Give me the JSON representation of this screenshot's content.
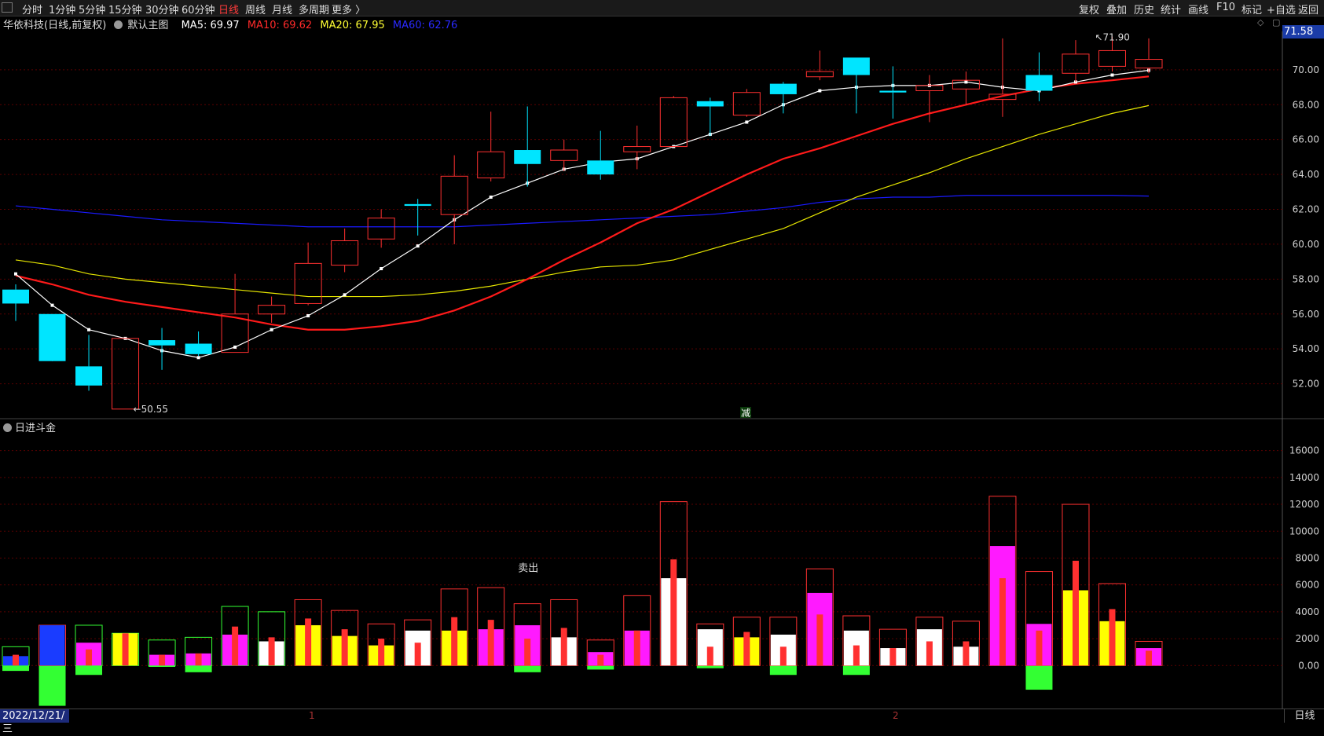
{
  "toolbar": {
    "periods": [
      "分时",
      "1分钟",
      "5分钟",
      "15分钟",
      "30分钟",
      "60分钟",
      "日线",
      "周线",
      "月线",
      "多周期",
      "更多 〉"
    ],
    "active_period": "日线",
    "right_items": [
      "复权",
      "叠加",
      "历史",
      "统计",
      "画线",
      "F10",
      "标记",
      "+自选",
      "返回"
    ]
  },
  "stock": {
    "name": "华依科技(日线,前复权)",
    "template": "默认主图",
    "ma5": "MA5: 69.97",
    "ma10": "MA10: 69.62",
    "ma20": "MA20: 67.95",
    "ma60": "MA60: 62.76"
  },
  "colors": {
    "up": "#ff3030",
    "down": "#00e5ff",
    "ma5": "#ffffff",
    "ma10": "#ff1a1a",
    "ma20": "#e6e600",
    "ma60": "#1a1aff",
    "grid": "#5a0000",
    "axis_text": "#d0d0d0",
    "magenta": "#ff1aff",
    "green": "#33ff33",
    "blue": "#1a3cff",
    "yellow": "#ffff00"
  },
  "price_axis": {
    "ticks": [
      "70.00",
      "68.00",
      "66.00",
      "64.00",
      "62.00",
      "60.00",
      "58.00",
      "56.00",
      "54.00",
      "52.00"
    ],
    "current": "71.58"
  },
  "annotations": {
    "high": "71.90",
    "low": "50.55",
    "mid_marker": "减",
    "sell": "卖出"
  },
  "panel2": {
    "title": "日进斗金",
    "ticks": [
      "16000",
      "14000",
      "12000",
      "10000",
      "8000",
      "6000",
      "4000",
      "2000",
      "0.00"
    ]
  },
  "bottom": {
    "date": "2022/12/21/三",
    "period": "日线",
    "month1": "1",
    "month2": "2"
  },
  "chart_data": [
    {
      "type": "candlestick",
      "ylim": [
        50,
        72.2
      ],
      "candles": [
        {
          "o": 57.4,
          "h": 57.7,
          "l": 55.6,
          "c": 56.6
        },
        {
          "o": 56.0,
          "h": 56.0,
          "l": 53.4,
          "c": 53.3
        },
        {
          "o": 53.0,
          "h": 54.8,
          "l": 51.6,
          "c": 51.9
        },
        {
          "o": 50.55,
          "h": 54.6,
          "l": 50.55,
          "c": 54.6
        },
        {
          "o": 54.5,
          "h": 55.2,
          "l": 52.8,
          "c": 54.2
        },
        {
          "o": 54.3,
          "h": 55.0,
          "l": 53.6,
          "c": 53.7
        },
        {
          "o": 53.8,
          "h": 58.3,
          "l": 53.8,
          "c": 56.0
        },
        {
          "o": 56.0,
          "h": 57.0,
          "l": 55.5,
          "c": 56.5
        },
        {
          "o": 56.6,
          "h": 60.1,
          "l": 56.5,
          "c": 58.9
        },
        {
          "o": 58.8,
          "h": 60.9,
          "l": 58.4,
          "c": 60.2
        },
        {
          "o": 60.3,
          "h": 62.0,
          "l": 59.8,
          "c": 61.5
        },
        {
          "o": 62.3,
          "h": 62.6,
          "l": 60.5,
          "c": 62.2
        },
        {
          "o": 61.7,
          "h": 65.1,
          "l": 60.0,
          "c": 63.9
        },
        {
          "o": 63.8,
          "h": 67.6,
          "l": 63.6,
          "c": 65.3
        },
        {
          "o": 65.4,
          "h": 67.9,
          "l": 63.3,
          "c": 64.6
        },
        {
          "o": 64.8,
          "h": 66.0,
          "l": 64.2,
          "c": 65.4
        },
        {
          "o": 64.8,
          "h": 66.5,
          "l": 63.7,
          "c": 64.0
        },
        {
          "o": 65.3,
          "h": 66.8,
          "l": 64.3,
          "c": 65.6
        },
        {
          "o": 65.6,
          "h": 68.5,
          "l": 65.6,
          "c": 68.4
        },
        {
          "o": 68.2,
          "h": 68.4,
          "l": 66.2,
          "c": 67.9
        },
        {
          "o": 67.4,
          "h": 68.9,
          "l": 67.3,
          "c": 68.7
        },
        {
          "o": 69.2,
          "h": 69.3,
          "l": 67.5,
          "c": 68.6
        },
        {
          "o": 69.6,
          "h": 71.1,
          "l": 69.4,
          "c": 69.9
        },
        {
          "o": 70.7,
          "h": 70.7,
          "l": 67.5,
          "c": 69.7
        },
        {
          "o": 68.8,
          "h": 70.2,
          "l": 67.2,
          "c": 68.7
        },
        {
          "o": 68.8,
          "h": 69.7,
          "l": 67.0,
          "c": 69.1
        },
        {
          "o": 68.9,
          "h": 69.9,
          "l": 68.0,
          "c": 69.4
        },
        {
          "o": 68.3,
          "h": 71.8,
          "l": 67.3,
          "c": 68.6
        },
        {
          "o": 69.7,
          "h": 71.0,
          "l": 68.2,
          "c": 68.8
        },
        {
          "o": 69.8,
          "h": 71.7,
          "l": 69.3,
          "c": 70.9
        },
        {
          "o": 70.2,
          "h": 71.9,
          "l": 69.9,
          "c": 71.1
        },
        {
          "o": 70.1,
          "h": 71.8,
          "l": 69.8,
          "c": 70.6
        }
      ],
      "ma5": [
        58.3,
        56.5,
        55.1,
        54.6,
        53.9,
        53.5,
        54.1,
        55.1,
        55.9,
        57.1,
        58.6,
        59.9,
        61.4,
        62.7,
        63.5,
        64.3,
        64.7,
        64.9,
        65.6,
        66.3,
        67.0,
        68.0,
        68.8,
        69.0,
        69.1,
        69.1,
        69.3,
        69.0,
        68.8,
        69.3,
        69.7,
        69.97
      ],
      "ma10": [
        58.2,
        57.7,
        57.1,
        56.7,
        56.4,
        56.1,
        55.8,
        55.4,
        55.1,
        55.1,
        55.3,
        55.6,
        56.2,
        57.0,
        58.0,
        59.1,
        60.1,
        61.2,
        62.0,
        63.0,
        64.0,
        64.9,
        65.5,
        66.2,
        66.9,
        67.5,
        68.0,
        68.5,
        68.9,
        69.2,
        69.4,
        69.62
      ],
      "ma20": [
        59.1,
        58.8,
        58.3,
        58.0,
        57.8,
        57.6,
        57.4,
        57.2,
        57.0,
        57.0,
        57.0,
        57.1,
        57.3,
        57.6,
        58.0,
        58.4,
        58.7,
        58.8,
        59.1,
        59.7,
        60.3,
        60.9,
        61.8,
        62.7,
        63.4,
        64.1,
        64.9,
        65.6,
        66.3,
        66.9,
        67.5,
        67.95
      ],
      "ma60": [
        62.2,
        62.0,
        61.8,
        61.6,
        61.4,
        61.3,
        61.2,
        61.1,
        61.0,
        61.0,
        61.0,
        61.0,
        61.0,
        61.1,
        61.2,
        61.3,
        61.4,
        61.5,
        61.6,
        61.7,
        61.9,
        62.1,
        62.4,
        62.6,
        62.7,
        62.7,
        62.8,
        62.8,
        62.8,
        62.8,
        62.8,
        62.76
      ]
    },
    {
      "type": "bar",
      "ylim": [
        -3200,
        17500
      ],
      "bars": [
        {
          "outer": 1400,
          "oc": "green",
          "fill": 700,
          "fc": "blue",
          "mid": 800,
          "mc": "red",
          "neg": -400
        },
        {
          "outer": 3000,
          "oc": "red",
          "fill": 3000,
          "fc": "blue",
          "mid": 0,
          "mc": "red",
          "neg": -3000
        },
        {
          "outer": 3000,
          "oc": "green",
          "fill": 1700,
          "fc": "magenta",
          "mid": 1200,
          "mc": "red",
          "neg": -700
        },
        {
          "outer": 2400,
          "oc": "green",
          "fill": 2400,
          "fc": "yellow",
          "mid": 2400,
          "mc": "red",
          "neg": 0
        },
        {
          "outer": 1900,
          "oc": "green",
          "fill": 800,
          "fc": "magenta",
          "mid": 800,
          "mc": "red",
          "neg": -100
        },
        {
          "outer": 2100,
          "oc": "green",
          "fill": 900,
          "fc": "magenta",
          "mid": 900,
          "mc": "red",
          "neg": -500
        },
        {
          "outer": 4400,
          "oc": "green",
          "fill": 2300,
          "fc": "magenta",
          "mid": 2900,
          "mc": "red",
          "neg": 0
        },
        {
          "outer": 4000,
          "oc": "green",
          "fill": 1800,
          "fc": "white",
          "mid": 2100,
          "mc": "red",
          "neg": 0
        },
        {
          "outer": 4900,
          "oc": "red",
          "fill": 3000,
          "fc": "yellow",
          "mid": 3500,
          "mc": "red",
          "neg": 0
        },
        {
          "outer": 4100,
          "oc": "red",
          "fill": 2200,
          "fc": "yellow",
          "mid": 2700,
          "mc": "red",
          "neg": 0
        },
        {
          "outer": 3100,
          "oc": "red",
          "fill": 1500,
          "fc": "yellow",
          "mid": 2000,
          "mc": "red",
          "neg": 0
        },
        {
          "outer": 3400,
          "oc": "red",
          "fill": 2600,
          "fc": "white",
          "mid": 1700,
          "mc": "red",
          "neg": 0
        },
        {
          "outer": 5700,
          "oc": "red",
          "fill": 2600,
          "fc": "yellow",
          "mid": 3600,
          "mc": "red",
          "neg": 0
        },
        {
          "outer": 5800,
          "oc": "red",
          "fill": 2700,
          "fc": "magenta",
          "mid": 3400,
          "mc": "red",
          "neg": 0
        },
        {
          "outer": 4600,
          "oc": "red",
          "fill": 3000,
          "fc": "magenta",
          "mid": 2000,
          "mc": "red",
          "neg": -500
        },
        {
          "outer": 4900,
          "oc": "red",
          "fill": 2100,
          "fc": "white",
          "mid": 2800,
          "mc": "red",
          "neg": 0
        },
        {
          "outer": 1900,
          "oc": "red",
          "fill": 1000,
          "fc": "magenta",
          "mid": 800,
          "mc": "red",
          "neg": -300
        },
        {
          "outer": 5200,
          "oc": "red",
          "fill": 2600,
          "fc": "magenta",
          "mid": 2600,
          "mc": "red",
          "neg": 0
        },
        {
          "outer": 12200,
          "oc": "red",
          "fill": 6500,
          "fc": "white",
          "mid": 7900,
          "mc": "red",
          "neg": 0
        },
        {
          "outer": 3100,
          "oc": "red",
          "fill": 2700,
          "fc": "white",
          "mid": 1400,
          "mc": "red",
          "neg": -200
        },
        {
          "outer": 3600,
          "oc": "red",
          "fill": 2100,
          "fc": "yellow",
          "mid": 2500,
          "mc": "red",
          "neg": 0
        },
        {
          "outer": 3600,
          "oc": "red",
          "fill": 2300,
          "fc": "white",
          "mid": 1400,
          "mc": "red",
          "neg": -700
        },
        {
          "outer": 7200,
          "oc": "red",
          "fill": 5400,
          "fc": "magenta",
          "mid": 3800,
          "mc": "red",
          "neg": 0
        },
        {
          "outer": 3700,
          "oc": "red",
          "fill": 2600,
          "fc": "white",
          "mid": 1500,
          "mc": "red",
          "neg": -700
        },
        {
          "outer": 2700,
          "oc": "red",
          "fill": 1300,
          "fc": "white",
          "mid": 1300,
          "mc": "red",
          "neg": 0
        },
        {
          "outer": 3600,
          "oc": "red",
          "fill": 2700,
          "fc": "white",
          "mid": 1800,
          "mc": "red",
          "neg": 0
        },
        {
          "outer": 3300,
          "oc": "red",
          "fill": 1400,
          "fc": "white",
          "mid": 1800,
          "mc": "red",
          "neg": 0
        },
        {
          "outer": 12600,
          "oc": "red",
          "fill": 8900,
          "fc": "magenta",
          "mid": 6500,
          "mc": "red",
          "neg": 0
        },
        {
          "outer": 7000,
          "oc": "red",
          "fill": 3100,
          "fc": "magenta",
          "mid": 2600,
          "mc": "red",
          "neg": -1800
        },
        {
          "outer": 12000,
          "oc": "red",
          "fill": 5600,
          "fc": "yellow",
          "mid": 7800,
          "mc": "red",
          "neg": 0
        },
        {
          "outer": 6100,
          "oc": "red",
          "fill": 3300,
          "fc": "yellow",
          "mid": 4200,
          "mc": "red",
          "neg": 0
        },
        {
          "outer": 1800,
          "oc": "red",
          "fill": 1300,
          "fc": "magenta",
          "mid": 1100,
          "mc": "red",
          "neg": 0
        }
      ]
    }
  ]
}
